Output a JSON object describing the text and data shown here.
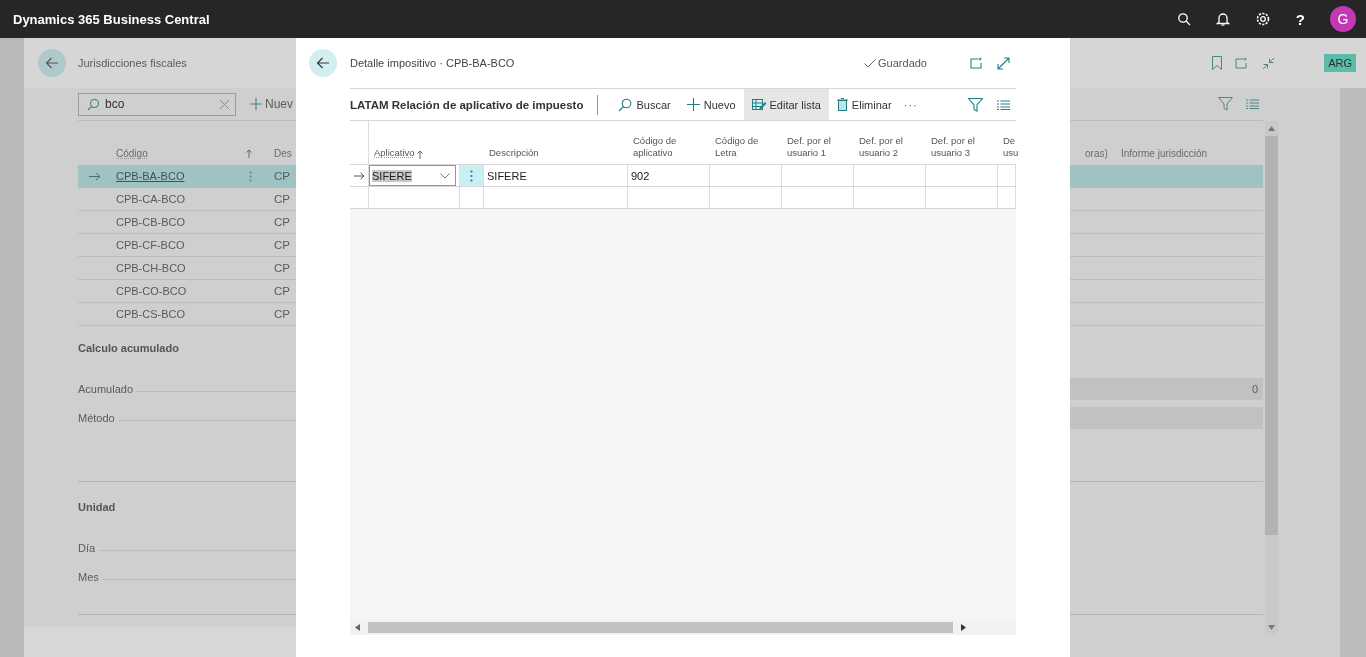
{
  "app_bar": {
    "title": "Dynamics 365 Business Central",
    "help": "?",
    "avatar": "G"
  },
  "list_page": {
    "title": "Jurisdicciones fiscales",
    "search": {
      "value": "bco"
    },
    "new_action": "Nuev",
    "badge": "ARG",
    "columns": [
      {
        "label": "Código",
        "sorted": true
      },
      {
        "label": "Des",
        "sorted": false
      },
      {
        "label": "oras)",
        "sorted": false
      },
      {
        "label": "Informe jurisdicción",
        "sorted": false
      }
    ],
    "rows": [
      {
        "code": "CPB-BA-BCO",
        "column_2": "CP",
        "selected": true
      },
      {
        "code": "CPB-CA-BCO",
        "column_2": "CP",
        "selected": false
      },
      {
        "code": "CPB-CB-BCO",
        "column_2": "CP",
        "selected": false
      },
      {
        "code": "CPB-CF-BCO",
        "column_2": "CP",
        "selected": false
      },
      {
        "code": "CPB-CH-BCO",
        "column_2": "CP",
        "selected": false
      },
      {
        "code": "CPB-CO-BCO",
        "column_2": "CP",
        "selected": false
      },
      {
        "code": "CPB-CS-BCO",
        "column_2": "CP",
        "selected": false
      }
    ],
    "sections": [
      {
        "title": "Calculo acumulado",
        "fields": [
          {
            "label": "Acumulado",
            "kind": "box",
            "value": "0"
          },
          {
            "label": "Método",
            "kind": "box"
          }
        ]
      },
      {
        "title": "Unidad",
        "fields": [
          {
            "label": "Día",
            "kind": "plain"
          },
          {
            "label": "Mes",
            "kind": "plain"
          }
        ]
      }
    ]
  },
  "dialog": {
    "title": "Detalle impositivo · CPB-BA-BCO",
    "status": "Guardado",
    "list_title": "LATAM Relación de aplicativo de impuesto",
    "actions": [
      {
        "kind": "search",
        "label": "Buscar",
        "active": false
      },
      {
        "kind": "new",
        "label": "Nuevo",
        "active": false
      },
      {
        "kind": "edit",
        "label": "Editar lista",
        "active": true
      },
      {
        "kind": "delete",
        "label": "Eliminar",
        "active": false
      }
    ],
    "more": "···",
    "columns": [
      {
        "label": "Aplicativo",
        "sorted": true
      },
      {
        "label": "Descripción",
        "sorted": false
      },
      {
        "label": "Código de aplicativo",
        "sorted": false
      },
      {
        "label": "Código de Letra",
        "sorted": false
      },
      {
        "label": "Def. por el usuario 1",
        "sorted": false
      },
      {
        "label": "Def. por el usuario 2",
        "sorted": false
      },
      {
        "label": "Def. por el usuario 3",
        "sorted": false
      },
      {
        "label": "De usu",
        "sorted": false
      }
    ],
    "rows": [
      {
        "selected": true,
        "cells": [
          "SIFERE",
          "SIFERE",
          "902"
        ]
      },
      {
        "selected": false
      }
    ]
  }
}
